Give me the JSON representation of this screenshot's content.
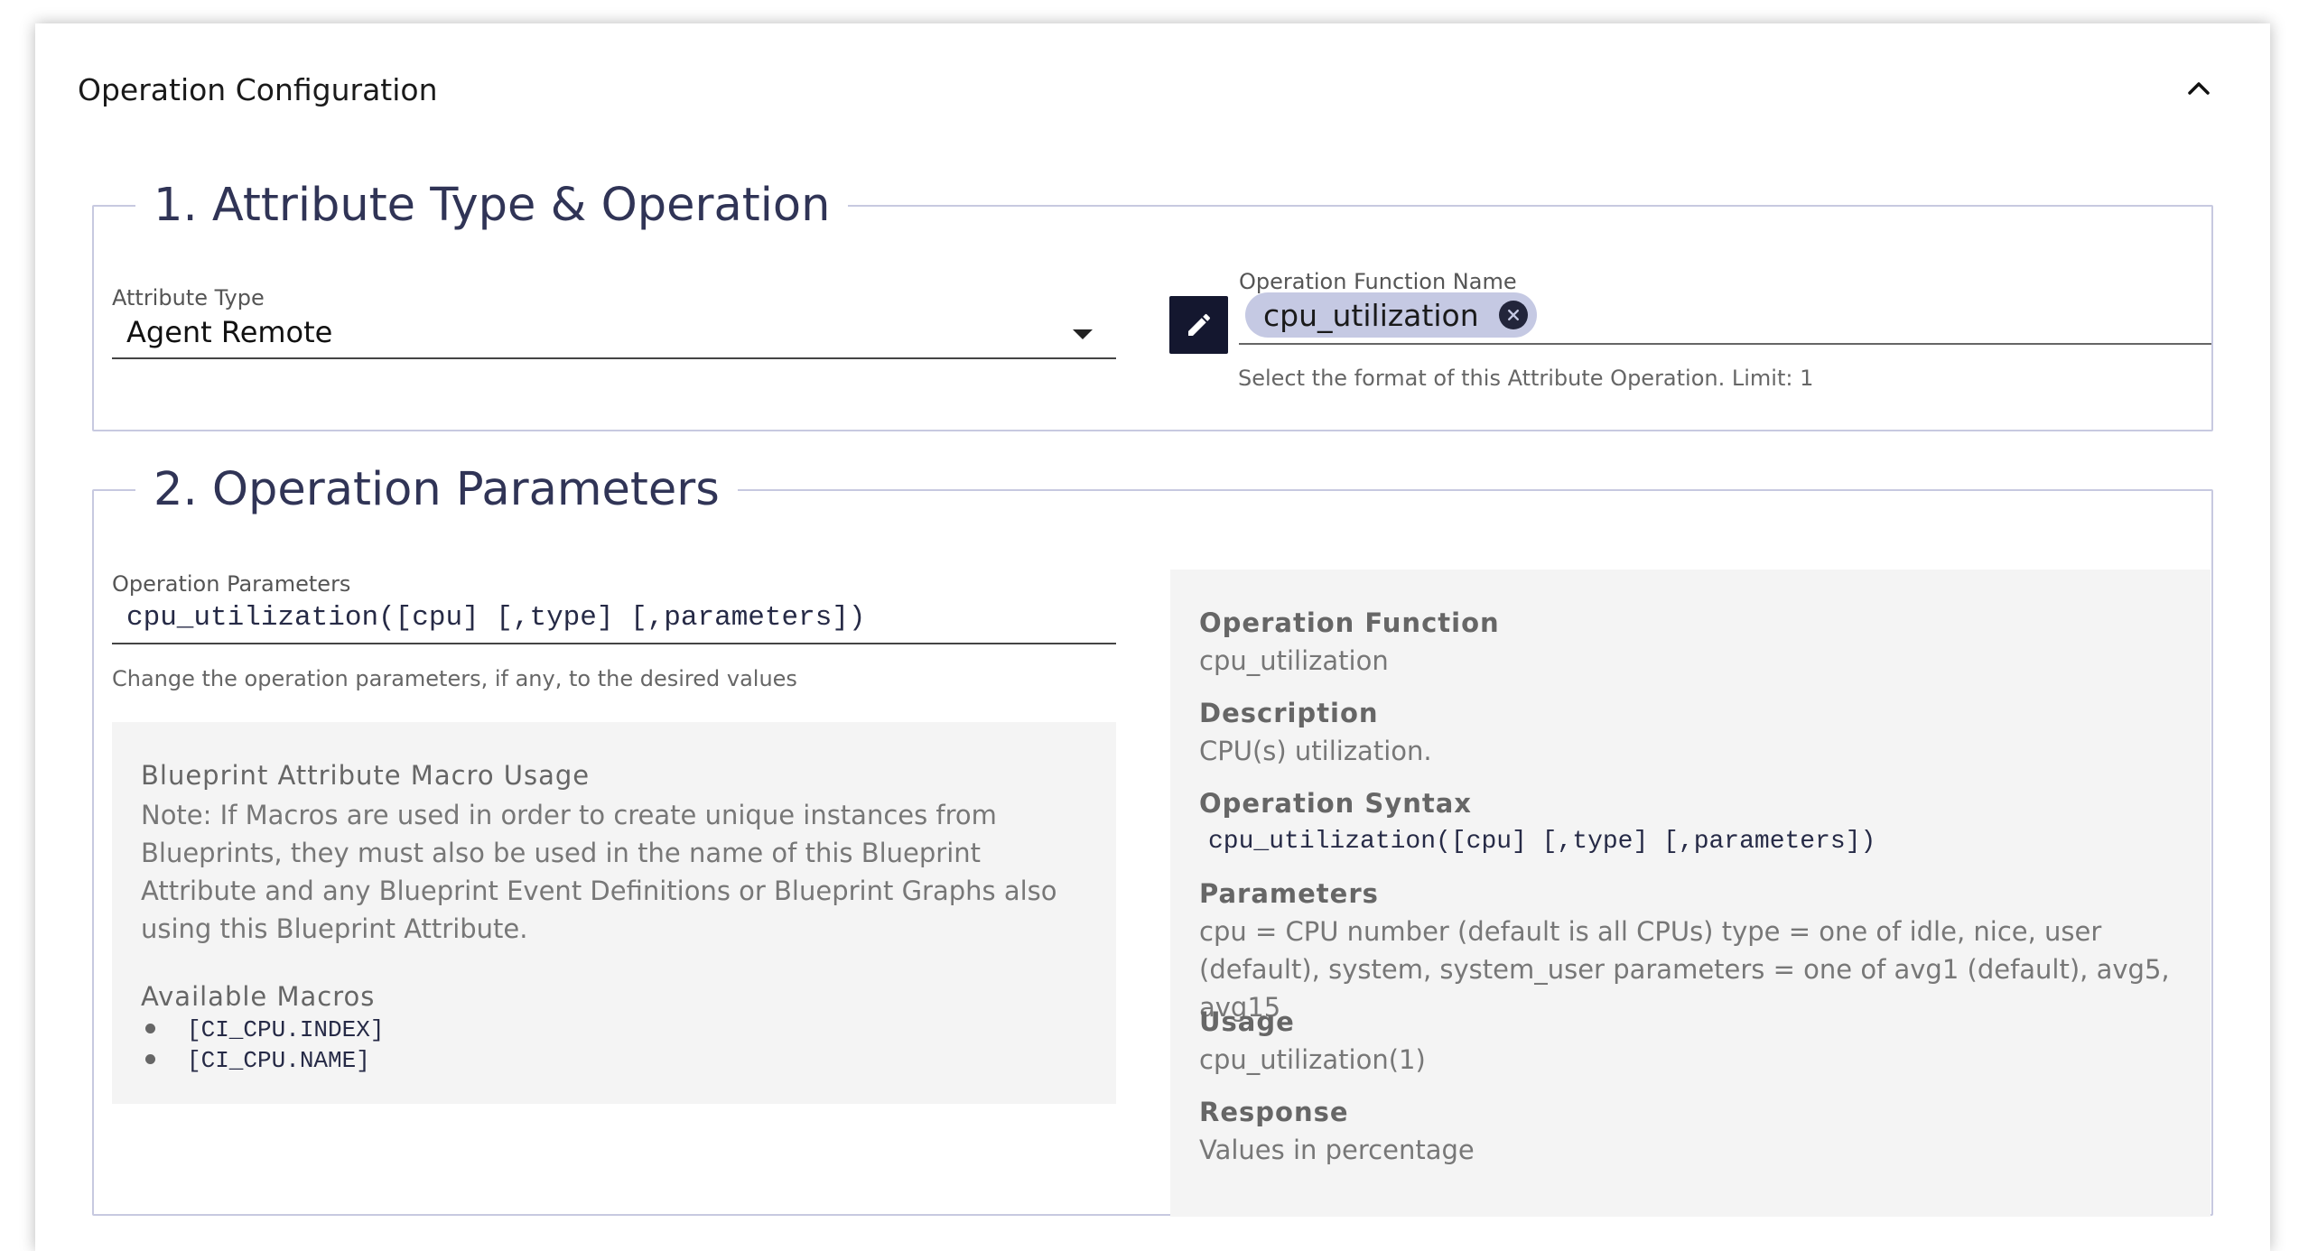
{
  "card": {
    "title": "Operation Configuration"
  },
  "section1": {
    "legend": "1. Attribute Type & Operation",
    "attribute_type": {
      "label": "Attribute Type",
      "value": "Agent Remote"
    },
    "operation_function_name": {
      "label": "Operation Function Name",
      "chip": "cpu_utilization",
      "hint": "Select the format of this Attribute Operation. Limit: 1"
    }
  },
  "section2": {
    "legend": "2. Operation Parameters",
    "operation_parameters": {
      "label": "Operation Parameters",
      "value": "cpu_utilization([cpu] [,type] [,parameters])",
      "hint": "Change the operation parameters, if any, to the desired values"
    },
    "macro_panel": {
      "heading": "Blueprint Attribute Macro Usage",
      "note": "Note: If Macros are used in order to create unique instances from Blueprints, they must also be used in the name of this Blueprint Attribute and any Blueprint Event Definitions or Blueprint Graphs also using this Blueprint Attribute.",
      "macros_heading": "Available Macros",
      "macros": [
        "[CI_CPU.INDEX]",
        "[CI_CPU.NAME]"
      ]
    },
    "info_panel": {
      "operation_function_heading": "Operation Function",
      "operation_function_value": "cpu_utilization",
      "description_heading": "Description",
      "description_value": "CPU(s) utilization.",
      "syntax_heading": "Operation Syntax",
      "syntax_value": "cpu_utilization([cpu] [,type] [,parameters])",
      "parameters_heading": "Parameters",
      "parameters_value": "cpu = CPU number (default is all CPUs) type = one of idle, nice, user (default), system, system_user parameters = one of avg1 (default), avg5, avg15",
      "usage_heading": "Usage",
      "usage_value": "cpu_utilization(1)",
      "response_heading": "Response",
      "response_value": "Values in percentage"
    }
  },
  "icons": [
    "chevron-up-icon",
    "dropdown-caret-icon",
    "pencil-icon",
    "close-circle-icon"
  ],
  "colors": {
    "accent_dark": "#14172f",
    "legend_text": "#303456",
    "chip_bg": "#c5c9e3",
    "fieldset_border": "#c7c9e0",
    "panel_bg": "#f4f4f4"
  }
}
